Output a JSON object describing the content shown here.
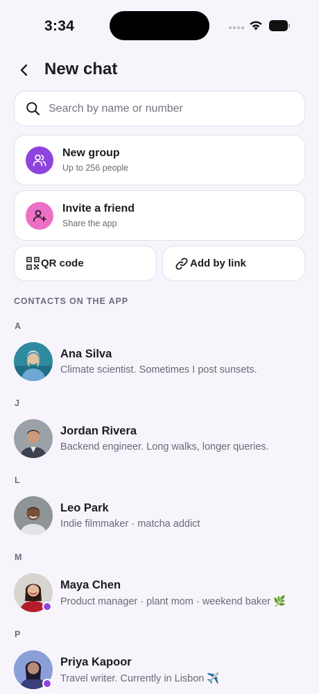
{
  "status_bar": {
    "time": "3:34"
  },
  "header": {
    "title": "New chat",
    "back_icon": "chevron-left-icon"
  },
  "search": {
    "placeholder": "Search by name or number",
    "value": "",
    "icon": "search-icon"
  },
  "actions": [
    {
      "title": "New group",
      "subtitle": "Up to 256 people",
      "icon": "group-icon",
      "color": "#8e44dd"
    },
    {
      "title": "Invite a friend",
      "subtitle": "Share the app",
      "icon": "person-add-icon",
      "color": "#ee6fc6"
    }
  ],
  "quick_actions": [
    {
      "label": "QR code",
      "icon": "qr-code-icon"
    },
    {
      "label": "Add by link",
      "icon": "link-icon"
    }
  ],
  "contacts_section_title": "CONTACTS ON THE APP",
  "contacts": [
    {
      "letter": "A",
      "name": "Ana Silva",
      "bio": "Climate scientist. Sometimes I post sunsets.",
      "online": false
    },
    {
      "letter": "J",
      "name": "Jordan Rivera",
      "bio": "Backend engineer. Long walks, longer queries.",
      "online": false
    },
    {
      "letter": "L",
      "name": "Leo Park",
      "bio": "Indie filmmaker · matcha addict",
      "online": false
    },
    {
      "letter": "M",
      "name": "Maya Chen",
      "bio": "Product manager · plant mom · weekend baker 🌿",
      "online": true
    },
    {
      "letter": "P",
      "name": "Priya Kapoor",
      "bio": "Travel writer. Currently in Lisbon ✈️",
      "online": true
    }
  ],
  "colors": {
    "accent": "#8e44dd",
    "invite": "#ee6fc6",
    "background": "#f7f5fb"
  }
}
